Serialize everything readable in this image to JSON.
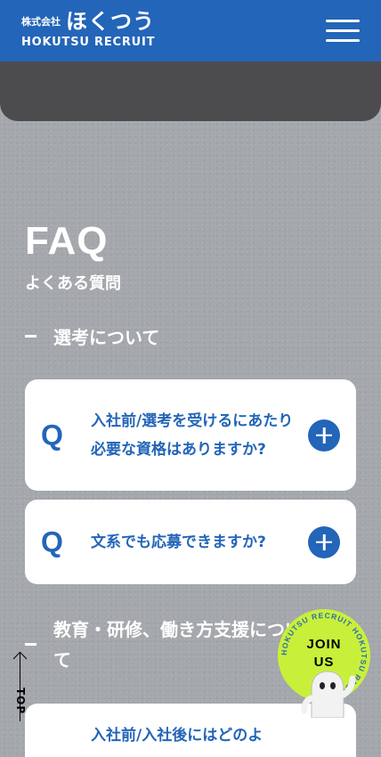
{
  "header": {
    "company_prefix": "株式会社",
    "logo_jp": "ほくつう",
    "logo_en": "HOKUTSU RECRUIT",
    "menu_icon": "hamburger-menu-icon",
    "brand_color": "#2365b8"
  },
  "faq": {
    "title": "FAQ",
    "subtitle": "よくある質問",
    "q_mark": "Q",
    "sections": [
      {
        "heading": "選考について",
        "questions": [
          "入社前/選考を受けるにあたり必要な資格はありますか?",
          "文系でも応募できますか?"
        ]
      },
      {
        "heading": "教育・研修、働き方支援について",
        "questions": [
          "入社前/入社後にはどのよ"
        ]
      }
    ]
  },
  "floating": {
    "top_label": "TOP",
    "join_label_1": "JOIN",
    "join_label_2": "US",
    "join_ring_text": "HOKUTSU RECRUIT HOKUTSU RECRUIT",
    "join_color": "#c8f03a"
  }
}
